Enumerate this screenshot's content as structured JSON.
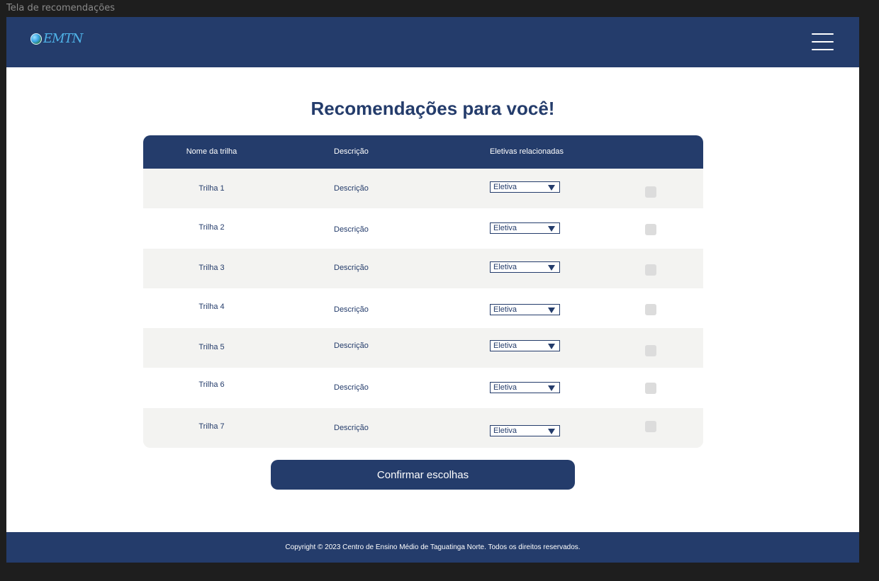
{
  "frame": {
    "label": "Tela de recomendações"
  },
  "header": {
    "logo_text": "EMTN"
  },
  "main": {
    "title": "Recomendações para você!",
    "table": {
      "columns": [
        "Nome da trilha",
        "Descrição",
        "Eletivas relacionadas"
      ],
      "rows": [
        {
          "name": "Trilha 1",
          "description": "Descrição",
          "elective": "Eletiva"
        },
        {
          "name": "Trilha 2",
          "description": "Descrição",
          "elective": "Eletiva"
        },
        {
          "name": "Trilha 3",
          "description": "Descrição",
          "elective": "Eletiva"
        },
        {
          "name": "Trilha 4",
          "description": "Descrição",
          "elective": "Eletiva"
        },
        {
          "name": "Trilha 5",
          "description": "Descrição",
          "elective": "Eletiva"
        },
        {
          "name": "Trilha 6",
          "description": "Descrição",
          "elective": "Eletiva"
        },
        {
          "name": "Trilha 7",
          "description": "Descrição",
          "elective": "Eletiva"
        }
      ]
    },
    "confirm_label": "Confirmar escolhas"
  },
  "footer": {
    "copyright": "Copyright © 2023 Centro de Ensino Médio de Taguatinga Norte. Todos os direitos reservados."
  },
  "colors": {
    "primary": "#243c6b",
    "row_alt": "#f3f3f1",
    "checkbox": "#dcdcdc",
    "canvas": "#1e1e1e"
  },
  "icons": {
    "menu": "hamburger-menu-icon",
    "logo": "globe-logo-icon",
    "dropdown": "triangle-down-icon"
  }
}
